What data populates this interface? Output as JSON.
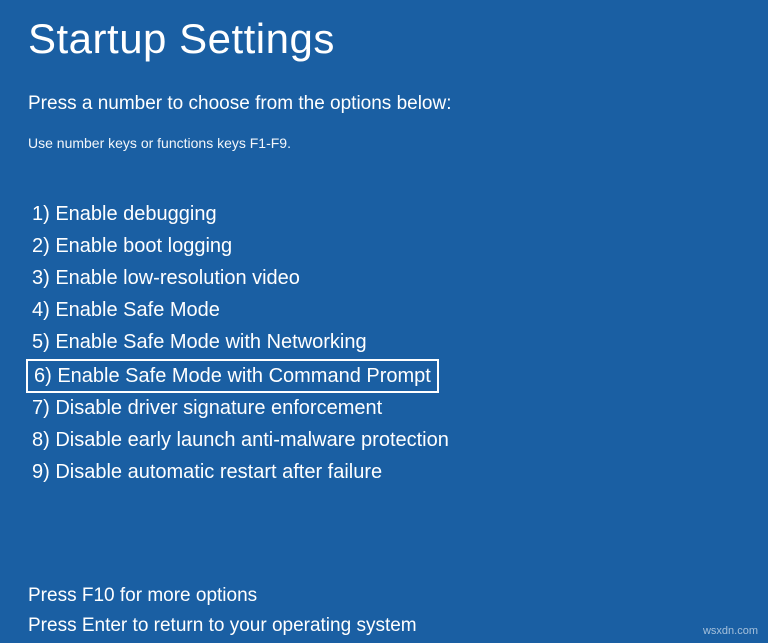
{
  "title": "Startup Settings",
  "subtitle": "Press a number to choose from the options below:",
  "hint": "Use number keys or functions keys F1-F9.",
  "options": [
    {
      "n": "1",
      "label": "Enable debugging",
      "highlighted": false
    },
    {
      "n": "2",
      "label": "Enable boot logging",
      "highlighted": false
    },
    {
      "n": "3",
      "label": "Enable low-resolution video",
      "highlighted": false
    },
    {
      "n": "4",
      "label": "Enable Safe Mode",
      "highlighted": false
    },
    {
      "n": "5",
      "label": "Enable Safe Mode with Networking",
      "highlighted": false
    },
    {
      "n": "6",
      "label": "Enable Safe Mode with Command Prompt",
      "highlighted": true
    },
    {
      "n": "7",
      "label": "Disable driver signature enforcement",
      "highlighted": false
    },
    {
      "n": "8",
      "label": "Disable early launch anti-malware protection",
      "highlighted": false
    },
    {
      "n": "9",
      "label": "Disable automatic restart after failure",
      "highlighted": false
    }
  ],
  "footer": {
    "more": "Press F10 for more options",
    "return": "Press Enter to return to your operating system"
  },
  "watermark": "wsxdn.com"
}
